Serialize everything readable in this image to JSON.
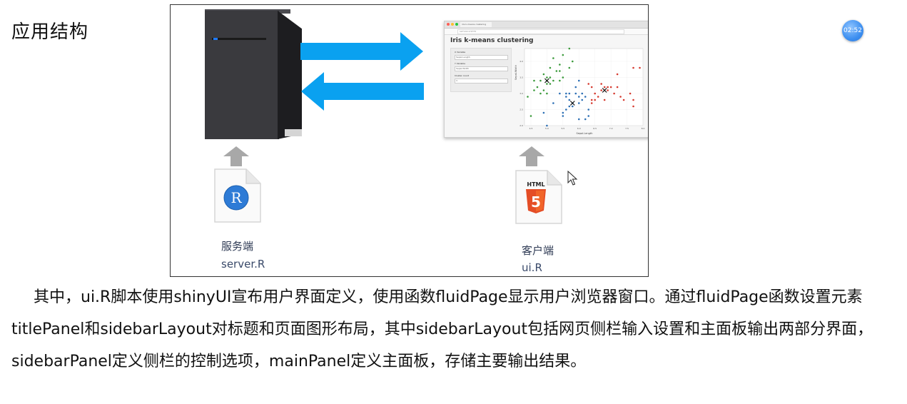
{
  "slide": {
    "heading": "应用结构",
    "timer": "02:52",
    "paragraph": "其中，ui.R脚本使用shinyUI宣布用户界面定义，使用函数fluidPage显示用户浏览器窗口。通过fluidPage函数设置元素titlePanel和sidebarLayout对标题和页面图形布局，其中sidebarLayout包括网页侧栏输入设置和主面板输出两部分界面，sidebarPanel定义侧栏的控制选项，mainPanel定义主面板，存储主要输出结果。"
  },
  "diagram": {
    "server_label": "服务端",
    "server_file": "server.R",
    "client_label": "客户端",
    "client_file": "ui.R",
    "r_logo_letter": "R",
    "html_logo_text": "HTML",
    "html_logo_digit": "5",
    "arrow_color": "#0aa1f0"
  },
  "browser": {
    "tab_text": "iris k-means clustering",
    "url_text": "127.0.0.1:5773",
    "app_title": "Iris k-means clustering",
    "x_variable_label": "X Variable",
    "x_variable_value": "Sepal.Length",
    "y_variable_label": "Y Variable",
    "y_variable_value": "Sepal.Width",
    "cluster_count_label": "Cluster count",
    "cluster_count_value": "3"
  },
  "chart_data": {
    "type": "scatter",
    "xlabel": "Sepal.Length",
    "ylabel": "Sepal.Width",
    "xlim": [
      4.3,
      8.0
    ],
    "ylim": [
      2.0,
      4.4
    ],
    "xticks": [
      "4.5",
      "5.0",
      "5.5",
      "6.0",
      "6.5",
      "7.0",
      "7.5",
      "8.0"
    ],
    "yticks": [
      "2.0",
      "2.5",
      "3.0",
      "3.5",
      "4.0"
    ],
    "series": [
      {
        "color": "#3a9a3a",
        "points": [
          [
            4.4,
            2.9
          ],
          [
            4.6,
            3.1
          ],
          [
            4.7,
            3.2
          ],
          [
            4.8,
            3.0
          ],
          [
            4.8,
            3.4
          ],
          [
            4.9,
            3.1
          ],
          [
            4.9,
            3.6
          ],
          [
            5.0,
            3.0
          ],
          [
            5.0,
            3.4
          ],
          [
            5.0,
            3.5
          ],
          [
            5.1,
            3.3
          ],
          [
            5.1,
            3.5
          ],
          [
            5.1,
            3.8
          ],
          [
            5.2,
            3.4
          ],
          [
            5.2,
            4.1
          ],
          [
            5.3,
            3.7
          ],
          [
            5.4,
            3.4
          ],
          [
            5.4,
            3.9
          ],
          [
            5.5,
            3.5
          ],
          [
            5.5,
            4.2
          ],
          [
            5.7,
            3.8
          ],
          [
            5.7,
            4.4
          ],
          [
            5.8,
            4.0
          ],
          [
            5.0,
            3.3
          ],
          [
            5.4,
            3.7
          ],
          [
            4.6,
            3.4
          ],
          [
            4.5,
            2.3
          ]
        ]
      },
      {
        "color": "#2c6fb5",
        "points": [
          [
            4.9,
            2.4
          ],
          [
            5.0,
            2.0
          ],
          [
            5.2,
            2.7
          ],
          [
            5.5,
            2.3
          ],
          [
            5.5,
            2.4
          ],
          [
            5.6,
            2.5
          ],
          [
            5.6,
            2.9
          ],
          [
            5.7,
            2.6
          ],
          [
            5.7,
            2.8
          ],
          [
            5.8,
            2.7
          ],
          [
            5.8,
            2.6
          ],
          [
            5.9,
            3.0
          ],
          [
            6.0,
            2.2
          ],
          [
            6.0,
            2.7
          ],
          [
            6.0,
            2.9
          ],
          [
            6.1,
            2.8
          ],
          [
            6.1,
            3.0
          ],
          [
            6.2,
            2.2
          ],
          [
            6.2,
            2.9
          ],
          [
            6.3,
            2.3
          ],
          [
            6.3,
            2.5
          ],
          [
            5.6,
            3.0
          ],
          [
            5.9,
            3.2
          ],
          [
            6.0,
            3.4
          ],
          [
            5.4,
            3.0
          ],
          [
            5.7,
            3.0
          ]
        ]
      },
      {
        "color": "#d63a2f",
        "points": [
          [
            6.4,
            2.8
          ],
          [
            6.4,
            3.2
          ],
          [
            6.5,
            3.0
          ],
          [
            6.5,
            2.8
          ],
          [
            6.7,
            3.1
          ],
          [
            6.7,
            3.3
          ],
          [
            6.8,
            2.8
          ],
          [
            6.8,
            3.2
          ],
          [
            6.9,
            3.1
          ],
          [
            7.0,
            3.2
          ],
          [
            7.1,
            3.0
          ],
          [
            7.2,
            3.6
          ],
          [
            7.2,
            3.2
          ],
          [
            7.3,
            2.9
          ],
          [
            7.4,
            2.8
          ],
          [
            7.6,
            3.0
          ],
          [
            7.7,
            2.6
          ],
          [
            7.7,
            3.8
          ],
          [
            7.7,
            2.8
          ],
          [
            7.9,
            3.8
          ],
          [
            6.6,
            2.9
          ],
          [
            6.3,
            3.3
          ],
          [
            6.9,
            3.2
          ],
          [
            6.4,
            2.7
          ]
        ]
      }
    ],
    "centers": [
      [
        5.0,
        3.4
      ],
      [
        5.8,
        2.7
      ],
      [
        6.8,
        3.1
      ]
    ]
  }
}
